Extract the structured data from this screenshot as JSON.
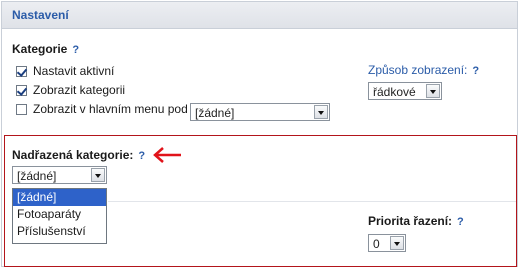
{
  "panel": {
    "title": "Nastavení"
  },
  "category_section": {
    "heading": "Kategorie",
    "help": "?",
    "set_active": {
      "label": "Nastavit aktivní",
      "checked": true
    },
    "show_category": {
      "label": "Zobrazit kategorii",
      "checked": true
    },
    "show_in_main_menu": {
      "label": "Zobrazit v hlavním menu pod",
      "checked": false,
      "select_value": "[žádné]"
    }
  },
  "display_mode": {
    "label": "Způsob zobrazení:",
    "help": "?",
    "select_value": "řádkové"
  },
  "parent_category": {
    "label": "Nadřazená kategorie:",
    "help": "?",
    "select_value": "[žádné]",
    "options": [
      "[žádné]",
      "Fotoaparáty",
      "Příslušenství"
    ],
    "selected_index": 0
  },
  "sort_priority": {
    "label": "Priorita řazení:",
    "help": "?",
    "select_value": "0"
  },
  "colors": {
    "accent": "#2b5ca8",
    "highlight_border": "#b3151b",
    "arrow": "#e1131a",
    "selection": "#2e62c9"
  }
}
